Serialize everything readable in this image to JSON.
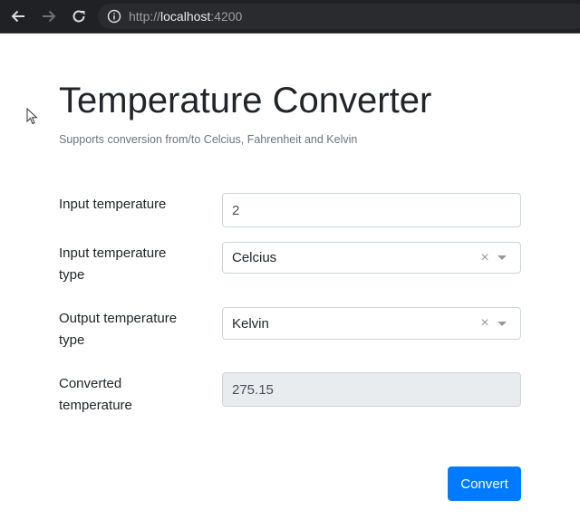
{
  "browser": {
    "url_scheme": "http://",
    "url_host": "localhost",
    "url_port": ":4200"
  },
  "page": {
    "title": "Temperature Converter",
    "subtitle": "Supports conversion from/to Celcius, Fahrenheit and Kelvin"
  },
  "form": {
    "input_temperature": {
      "label": "Input temperature",
      "value": "2"
    },
    "input_type": {
      "label_line1": "Input temperature",
      "label_line2": "type",
      "selected": "Celcius",
      "clear_glyph": "×"
    },
    "output_type": {
      "label_line1": "Output temperature",
      "label_line2": "type",
      "selected": "Kelvin",
      "clear_glyph": "×"
    },
    "converted": {
      "label_line1": "Converted",
      "label_line2": "temperature",
      "value": "275.15"
    },
    "convert_label": "Convert"
  },
  "colors": {
    "primary": "#007bff",
    "readonly_bg": "#e9ecef",
    "text": "#212529"
  }
}
